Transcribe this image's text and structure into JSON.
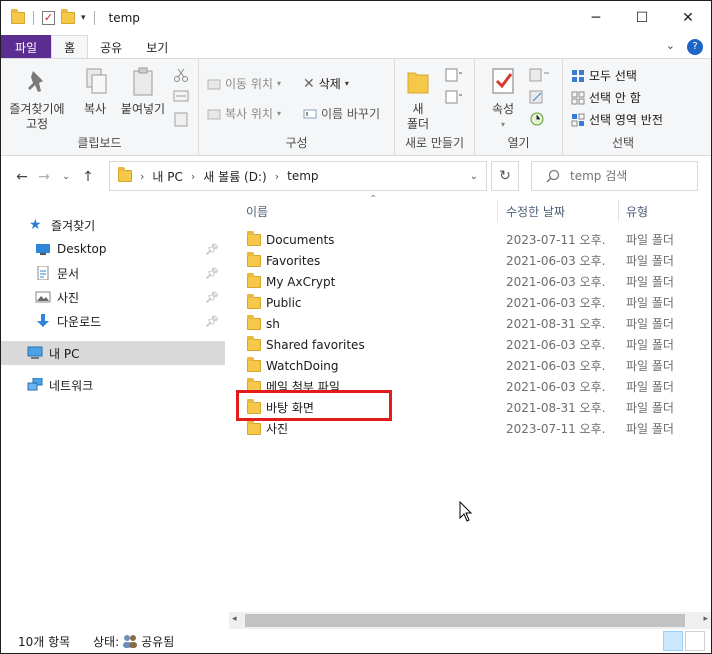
{
  "window": {
    "title": "temp",
    "minimize": "─",
    "maximize": "☐",
    "close": "✕"
  },
  "ribbon_tabs": {
    "file": "파일",
    "home": "홈",
    "share": "공유",
    "view": "보기",
    "help": "?"
  },
  "ribbon": {
    "clipboard": {
      "label": "클립보드",
      "pin_quick": "즐겨찾기에\n고정",
      "pin_quick_l1": "즐겨찾기에",
      "pin_quick_l2": "고정",
      "copy": "복사",
      "paste": "붙여넣기"
    },
    "organize": {
      "label": "구성",
      "move_to": "이동 위치",
      "copy_to": "복사 위치",
      "delete": "삭제",
      "rename": "이름 바꾸기"
    },
    "new": {
      "label": "새로 만들기",
      "new_folder_l1": "새",
      "new_folder_l2": "폴더"
    },
    "open": {
      "label": "열기",
      "properties": "속성"
    },
    "select": {
      "label": "선택",
      "select_all": "모두 선택",
      "select_none": "선택 안 함",
      "invert": "선택 영역 반전"
    }
  },
  "address": {
    "crumbs": [
      "내 PC",
      "새 볼륨 (D:)",
      "temp"
    ],
    "separator": "›",
    "search_placeholder": "temp 검색"
  },
  "nav": {
    "quick_access": "즐겨찾기",
    "desktop": "Desktop",
    "documents": "문서",
    "pictures": "사진",
    "downloads": "다운로드",
    "this_pc": "내 PC",
    "network": "네트워크"
  },
  "columns": {
    "name": "이름",
    "date": "수정한 날짜",
    "type": "유형"
  },
  "files": [
    {
      "name": "Documents",
      "date": "2023-07-11 오후...",
      "type": "파일 폴더"
    },
    {
      "name": "Favorites",
      "date": "2021-06-03 오후...",
      "type": "파일 폴더"
    },
    {
      "name": "My AxCrypt",
      "date": "2021-06-03 오후...",
      "type": "파일 폴더"
    },
    {
      "name": "Public",
      "date": "2021-06-03 오후...",
      "type": "파일 폴더"
    },
    {
      "name": "sh",
      "date": "2021-08-31 오후...",
      "type": "파일 폴더"
    },
    {
      "name": "Shared favorites",
      "date": "2021-06-03 오후...",
      "type": "파일 폴더"
    },
    {
      "name": "WatchDoing",
      "date": "2021-06-03 오후...",
      "type": "파일 폴더"
    },
    {
      "name": "메일 첨부 파일",
      "date": "2021-06-03 오후...",
      "type": "파일 폴더"
    },
    {
      "name": "바탕 화면",
      "date": "2021-08-31 오후...",
      "type": "파일 폴더"
    },
    {
      "name": "사진",
      "date": "2023-07-11 오후...",
      "type": "파일 폴더"
    }
  ],
  "status": {
    "count": "10개 항목",
    "state_label": "상태:",
    "state_value": "공유됨"
  },
  "colors": {
    "file_tab": "#5c2d91",
    "highlight": "#e31b1b",
    "folder": "#f5c84a"
  }
}
